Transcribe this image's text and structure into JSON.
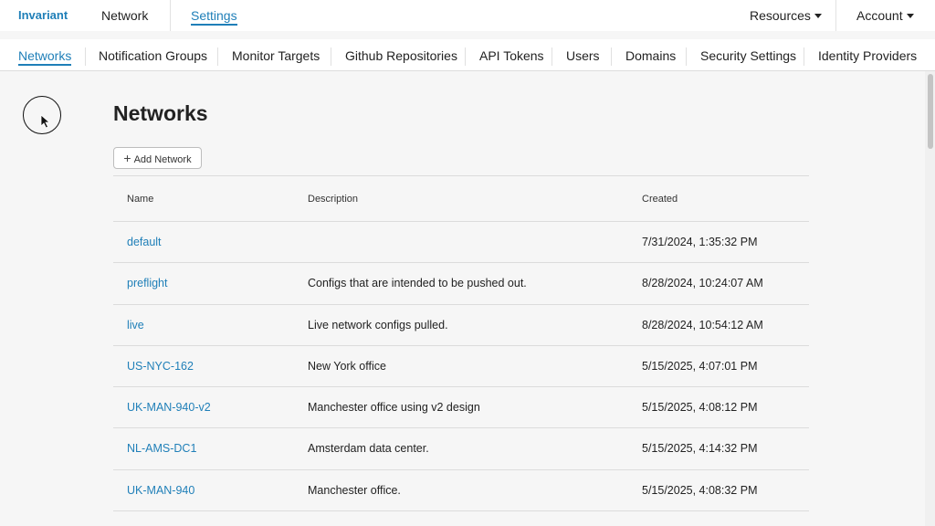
{
  "topnav": {
    "brand": "Invariant",
    "network": "Network",
    "settings": "Settings",
    "resources": "Resources",
    "account": "Account"
  },
  "subnav": {
    "tabs": [
      {
        "label": "Networks",
        "active": true
      },
      {
        "label": "Notification Groups"
      },
      {
        "label": "Monitor Targets"
      },
      {
        "label": "Github Repositories"
      },
      {
        "label": "API Tokens"
      },
      {
        "label": "Users"
      },
      {
        "label": "Domains"
      },
      {
        "label": "Security Settings"
      },
      {
        "label": "Identity Providers"
      }
    ]
  },
  "main": {
    "title": "Networks",
    "add_button": "Add Network",
    "columns": {
      "name": "Name",
      "description": "Description",
      "created": "Created"
    },
    "rows": [
      {
        "name": "default",
        "description": "",
        "created": "7/31/2024, 1:35:32 PM"
      },
      {
        "name": "preflight",
        "description": "Configs that are intended to be pushed out.",
        "created": "8/28/2024, 10:24:07 AM"
      },
      {
        "name": "live",
        "description": "Live network configs pulled.",
        "created": "8/28/2024, 10:54:12 AM"
      },
      {
        "name": "US-NYC-162",
        "description": "New York office",
        "created": "5/15/2025, 4:07:01 PM"
      },
      {
        "name": "UK-MAN-940-v2",
        "description": "Manchester office using v2 design",
        "created": "5/15/2025, 4:08:12 PM"
      },
      {
        "name": "NL-AMS-DC1",
        "description": "Amsterdam data center.",
        "created": "5/15/2025, 4:14:32 PM"
      },
      {
        "name": "UK-MAN-940",
        "description": "Manchester office.",
        "created": "5/15/2025, 4:08:32 PM"
      }
    ]
  },
  "colors": {
    "accent": "#1f7fb8",
    "background": "#f6f6f6"
  }
}
